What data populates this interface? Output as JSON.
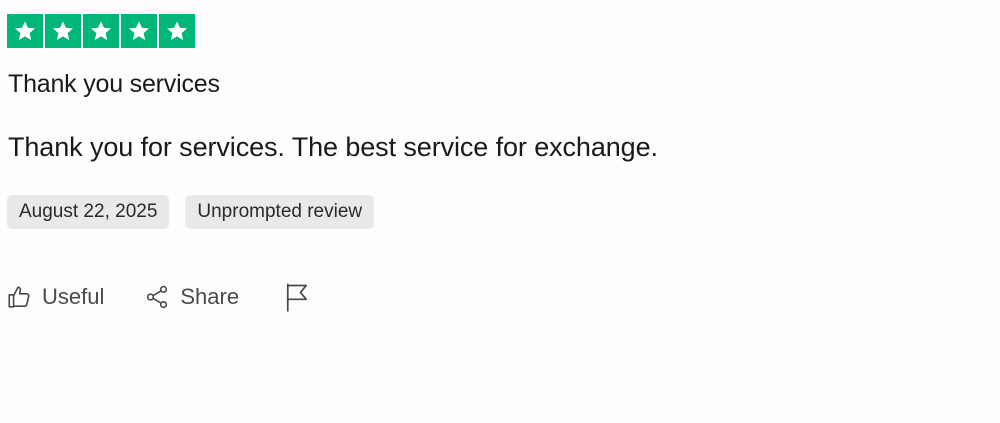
{
  "review": {
    "rating": 5,
    "rating_max": 5,
    "star_color": "#00b67a",
    "star_icon": "star-icon",
    "title": "Thank you services",
    "body": "Thank you for services. The best service for exchange.",
    "date": "August 22, 2025",
    "review_type": "Unprompted review"
  },
  "actions": {
    "useful_label": "Useful",
    "useful_icon": "thumbs-up-icon",
    "share_label": "Share",
    "share_icon": "share-icon",
    "report_icon": "flag-icon"
  }
}
